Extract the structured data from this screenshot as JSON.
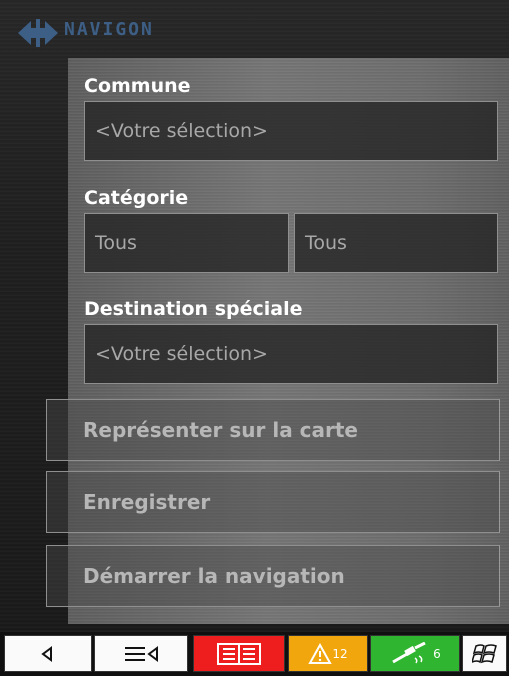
{
  "header": {
    "brand": "NAVIGON",
    "logo_icon": "navigon-logo-icon"
  },
  "form": {
    "commune_label": "Commune",
    "commune_value": "<Votre sélection>",
    "categorie_label": "Catégorie",
    "categorie_value_1": "Tous",
    "categorie_value_2": "Tous",
    "destination_label": "Destination spéciale",
    "destination_value": "<Votre sélection>"
  },
  "actions": {
    "show_on_map": "Représenter sur la carte",
    "save": "Enregistrer",
    "start_navigation": "Démarrer la navigation"
  },
  "toolbar": {
    "back_icon": "back-arrow-icon",
    "menu_icon": "menu-icon",
    "book_icon": "book-icon",
    "warning_icon": "warning-icon",
    "warning_count": "12",
    "gps_icon": "satellite-icon",
    "gps_count": "6",
    "windows_icon": "windows-flag-icon",
    "colors": {
      "book": "#ee1e1e",
      "warning": "#f2a60e",
      "gps": "#2fb52f"
    }
  },
  "colors": {
    "brand": "#3d5f86"
  }
}
